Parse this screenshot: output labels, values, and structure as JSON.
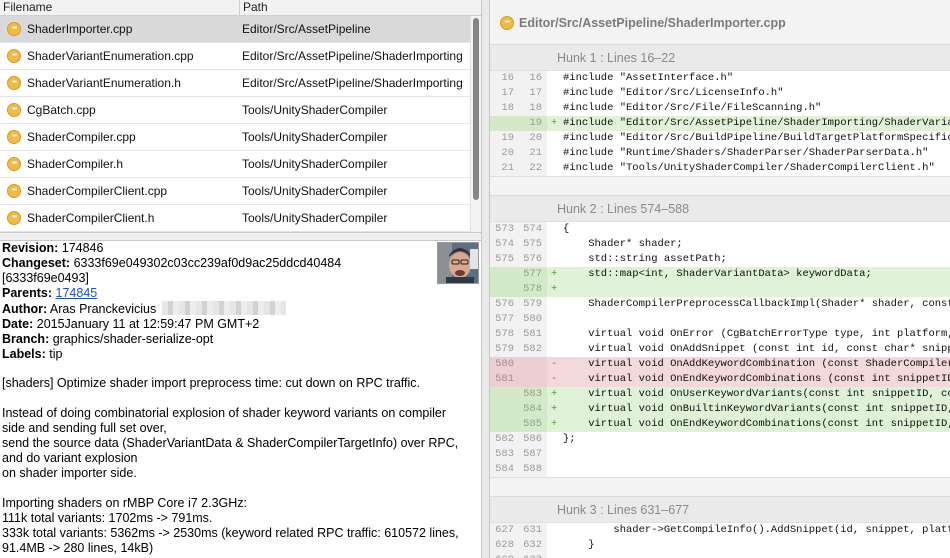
{
  "file_list": {
    "headers": {
      "filename": "Filename",
      "path": "Path"
    },
    "rows": [
      {
        "name": "ShaderImporter.cpp",
        "path": "Editor/Src/AssetPipeline"
      },
      {
        "name": "ShaderVariantEnumeration.cpp",
        "path": "Editor/Src/AssetPipeline/ShaderImporting"
      },
      {
        "name": "ShaderVariantEnumeration.h",
        "path": "Editor/Src/AssetPipeline/ShaderImporting"
      },
      {
        "name": "CgBatch.cpp",
        "path": "Tools/UnityShaderCompiler"
      },
      {
        "name": "ShaderCompiler.cpp",
        "path": "Tools/UnityShaderCompiler"
      },
      {
        "name": "ShaderCompiler.h",
        "path": "Tools/UnityShaderCompiler"
      },
      {
        "name": "ShaderCompilerClient.cpp",
        "path": "Tools/UnityShaderCompiler"
      },
      {
        "name": "ShaderCompilerClient.h",
        "path": "Tools/UnityShaderCompiler"
      }
    ]
  },
  "commit": {
    "revision_label": "Revision:",
    "revision": "174846",
    "changeset_label": "Changeset:",
    "changeset": "6333f69e049302c03cc239af0d9ac25ddcd40484",
    "changeset_short": "[6333f69e0493]",
    "parents_label": "Parents:",
    "parents": "174845",
    "author_label": "Author:",
    "author": "Aras Pranckevicius",
    "date_label": "Date:",
    "date": "2015January 11 at 12:59:47 PM GMT+2",
    "branch_label": "Branch:",
    "branch": "graphics/shader-serialize-opt",
    "labels_label": "Labels:",
    "labels": "tip"
  },
  "message_lines": [
    "[shaders] Optimize shader import preprocess time: cut down on RPC traffic.",
    "",
    "Instead of doing combinatorial explosion of shader keyword variants on compiler",
    "side and sending full set over,",
    "send the source data (ShaderVariantData & ShaderCompilerTargetInfo) over RPC,",
    "and do variant explosion",
    "on shader importer side.",
    "",
    "Importing shaders on rMBP Core i7 2.3GHz:",
    "111k total variants: 1702ms -> 791ms.",
    "333k total variants: 5362ms -> 2530ms (keyword related RPC traffic: 610572 lines,",
    "91.4MB -> 280 lines, 14kB)"
  ],
  "diff": {
    "file_path": "Editor/Src/AssetPipeline/ShaderImporter.cpp",
    "hunks": [
      {
        "title": "Hunk 1 : Lines 16–22",
        "lines": [
          {
            "type": "ctx",
            "old": "16",
            "new": "16",
            "code": "#include \"AssetInterface.h\""
          },
          {
            "type": "ctx",
            "old": "17",
            "new": "17",
            "code": "#include \"Editor/Src/LicenseInfo.h\""
          },
          {
            "type": "ctx",
            "old": "18",
            "new": "18",
            "code": "#include \"Editor/Src/File/FileScanning.h\""
          },
          {
            "type": "add",
            "old": "",
            "new": "19",
            "code": "#include \"Editor/Src/AssetPipeline/ShaderImporting/ShaderVariantEnumeration.h\""
          },
          {
            "type": "ctx",
            "old": "19",
            "new": "20",
            "code": "#include \"Editor/Src/BuildPipeline/BuildTargetPlatformSpecific.h\""
          },
          {
            "type": "ctx",
            "old": "20",
            "new": "21",
            "code": "#include \"Runtime/Shaders/ShaderParser/ShaderParserData.h\""
          },
          {
            "type": "ctx",
            "old": "21",
            "new": "22",
            "code": "#include \"Tools/UnityShaderCompiler/ShaderCompilerClient.h\""
          }
        ]
      },
      {
        "title": "Hunk 2 : Lines 574–588",
        "lines": [
          {
            "type": "ctx",
            "old": "573",
            "new": "574",
            "code": "{"
          },
          {
            "type": "ctx",
            "old": "574",
            "new": "575",
            "code": "    Shader* shader;"
          },
          {
            "type": "ctx",
            "old": "575",
            "new": "576",
            "code": "    std::string assetPath;"
          },
          {
            "type": "add",
            "old": "",
            "new": "577",
            "code": "    std::map<int, ShaderVariantData> keywordData;"
          },
          {
            "type": "add",
            "old": "",
            "new": "578",
            "code": ""
          },
          {
            "type": "ctx",
            "old": "576",
            "new": "579",
            "code": "    ShaderCompilerPreprocessCallbackImpl(Shader* shader, const std::string& assetPath)"
          },
          {
            "type": "ctx",
            "old": "577",
            "new": "580",
            "code": ""
          },
          {
            "type": "ctx",
            "old": "578",
            "new": "581",
            "code": "    virtual void OnError (CgBatchErrorType type, int platform, int line, const char* message)"
          },
          {
            "type": "ctx",
            "old": "579",
            "new": "582",
            "code": "    virtual void OnAddSnippet (const int id, const char* snippet, int startLine)"
          },
          {
            "type": "del",
            "old": "580",
            "new": "",
            "code": "    virtual void OnAddKeywordCombination (const ShaderCompilerProgram programType)"
          },
          {
            "type": "del",
            "old": "581",
            "new": "",
            "code": "    virtual void OnEndKeywordCombinations (const int snippetID, const int keywordCount)"
          },
          {
            "type": "add",
            "old": "",
            "new": "583",
            "code": "    virtual void OnUserKeywordVariants(const int snippetID, const ShaderCompilerProgram type)"
          },
          {
            "type": "add",
            "old": "",
            "new": "584",
            "code": "    virtual void OnBuiltinKeywordVariants(const int snippetID, const ShaderCompilerProgram type)"
          },
          {
            "type": "add",
            "old": "",
            "new": "585",
            "code": "    virtual void OnEndKeywordCombinations(const int snippetID, const ShaderCompilerProgram type)"
          },
          {
            "type": "ctx",
            "old": "582",
            "new": "586",
            "code": "};"
          },
          {
            "type": "ctx",
            "old": "583",
            "new": "587",
            "code": ""
          },
          {
            "type": "ctx",
            "old": "584",
            "new": "588",
            "code": ""
          }
        ]
      },
      {
        "title": "Hunk 3 : Lines 631–677",
        "lines": [
          {
            "type": "ctx",
            "old": "627",
            "new": "631",
            "code": "        shader->GetCompileInfo().AddSnippet(id, snippet, platforms, startLine);"
          },
          {
            "type": "ctx",
            "old": "628",
            "new": "632",
            "code": "    }"
          },
          {
            "type": "ctx",
            "old": "629",
            "new": "633",
            "code": ""
          }
        ]
      }
    ]
  },
  "colors": {
    "file_icon": "#f2ba45",
    "added_bg": "#dff1d6",
    "removed_bg": "#f4d9da",
    "link": "#1a4fd6"
  },
  "icons": {
    "file_status": "modified-file-icon",
    "avatar": "author-avatar"
  }
}
